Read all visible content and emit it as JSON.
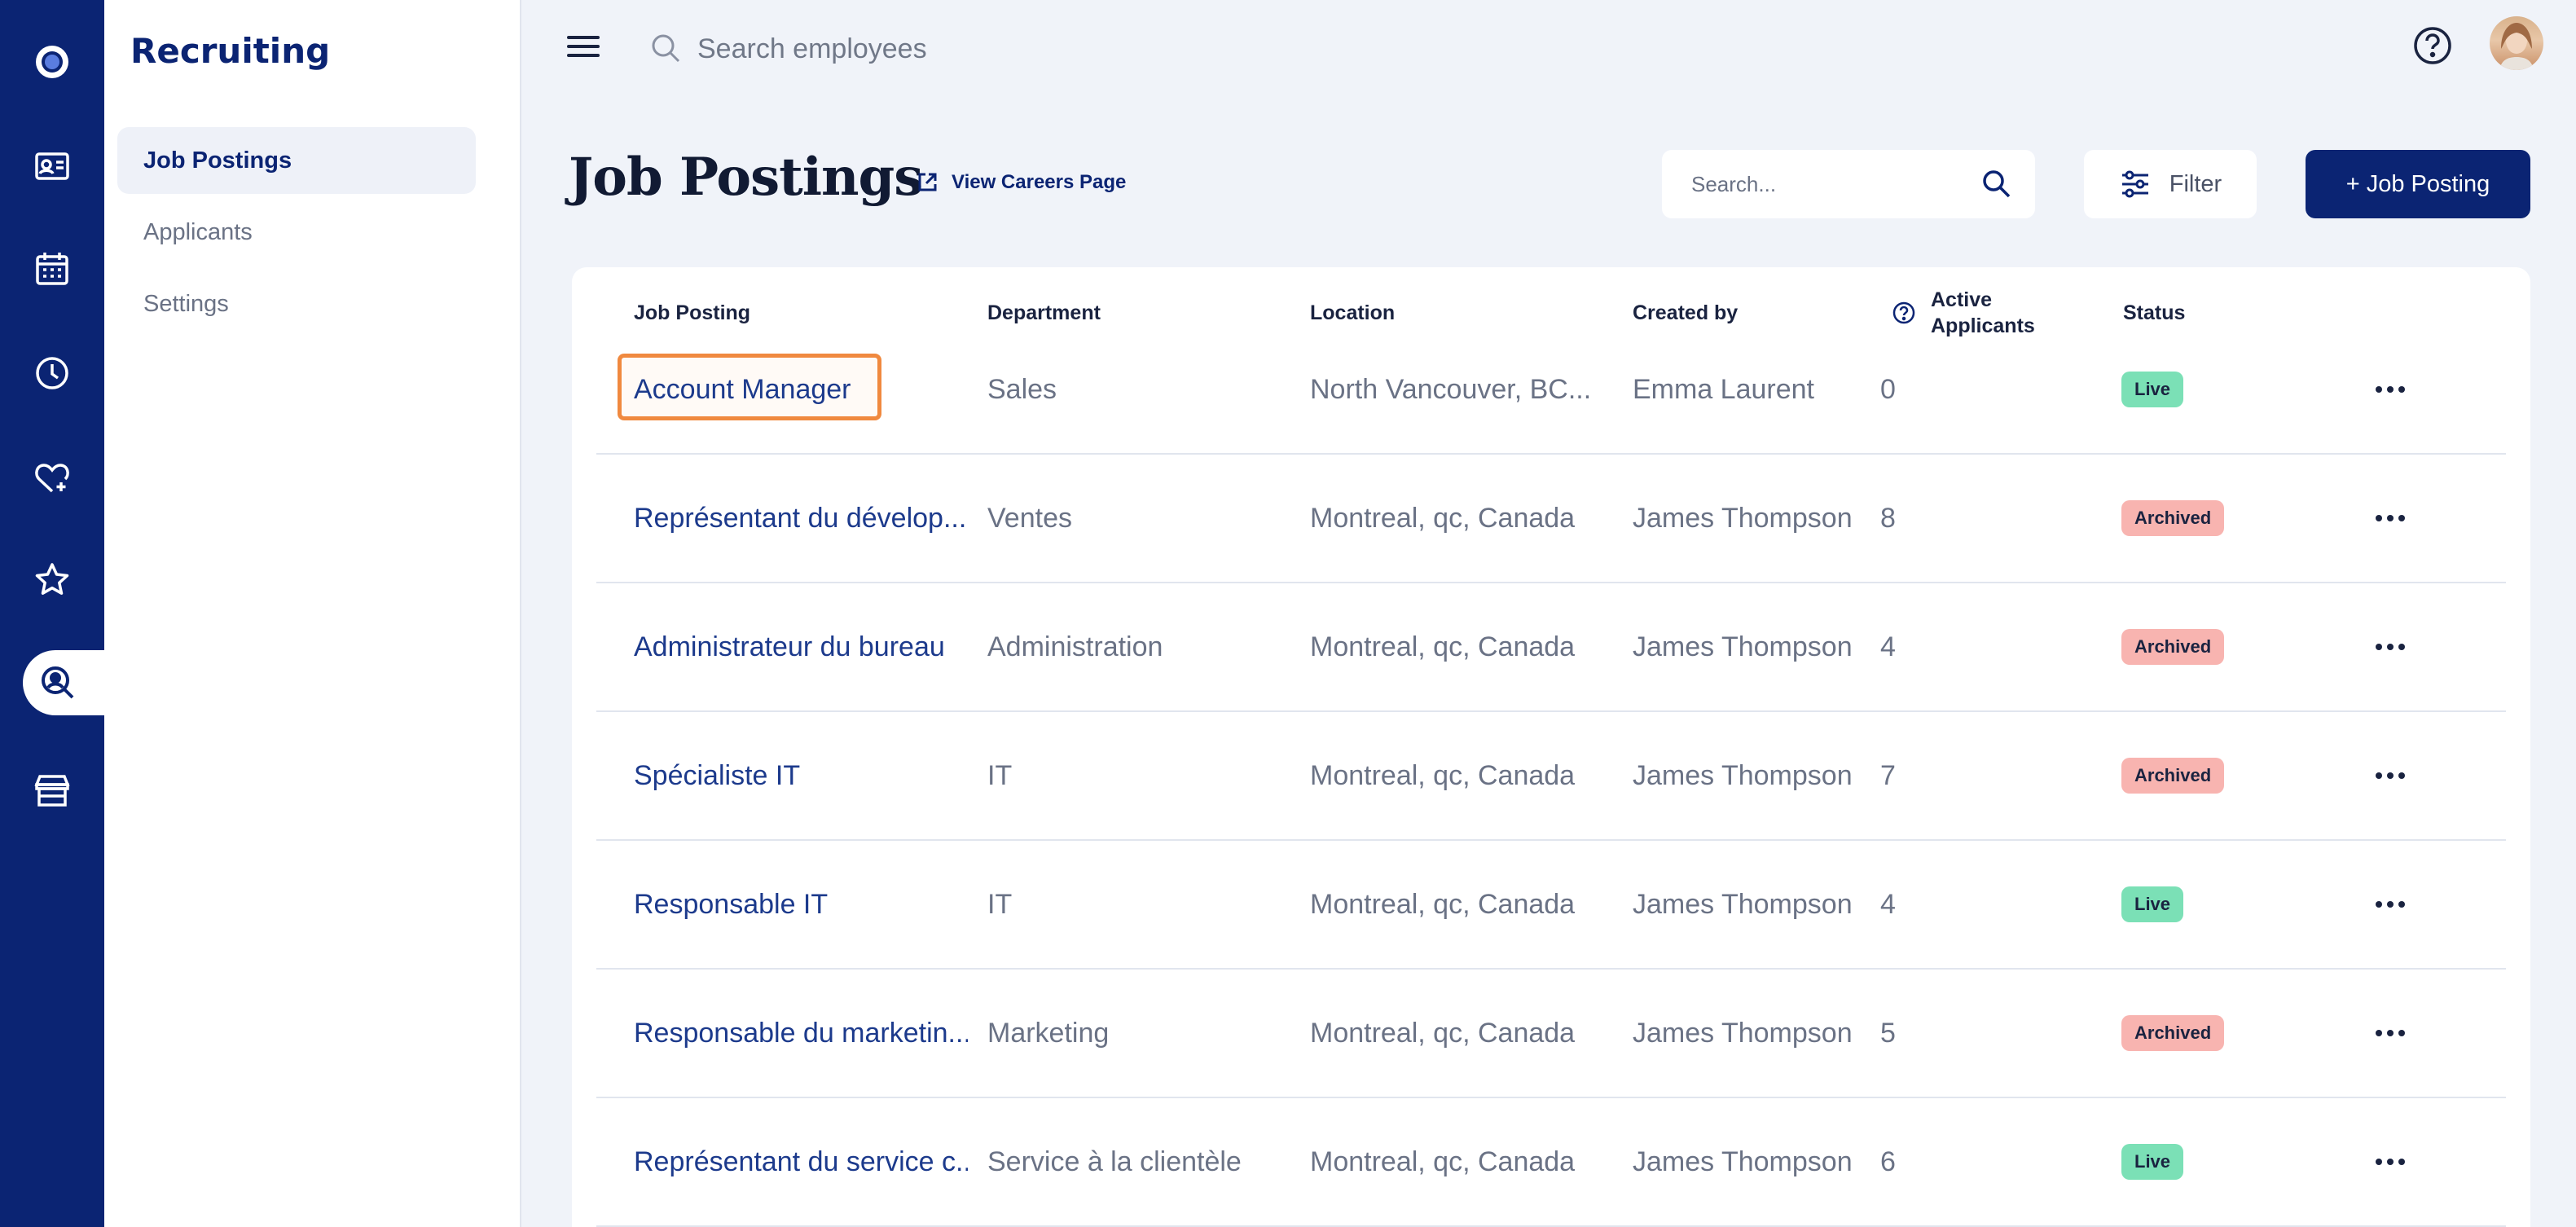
{
  "rail": {
    "items": [
      "logo-icon",
      "id-card-icon",
      "calendar-icon",
      "clock-icon",
      "heart-plus-icon",
      "star-icon",
      "recruiting-search-icon",
      "store-icon"
    ]
  },
  "subnav": {
    "title": "Recruiting",
    "items": [
      {
        "label": "Job Postings",
        "active": true
      },
      {
        "label": "Applicants",
        "active": false
      },
      {
        "label": "Settings",
        "active": false
      }
    ]
  },
  "topbar": {
    "search_placeholder": "Search employees"
  },
  "header": {
    "title": "Job Postings",
    "careers_link": "View Careers Page",
    "search_placeholder": "Search...",
    "filter_label": "Filter",
    "add_label": "+ Job Posting"
  },
  "table": {
    "columns": {
      "job": "Job Posting",
      "department": "Department",
      "location": "Location",
      "created_by": "Created by",
      "active_applicants_1": "Active",
      "active_applicants_2": "Applicants",
      "status": "Status"
    },
    "rows": [
      {
        "job": "Account Manager",
        "department": "Sales",
        "location": "North Vancouver, BC...",
        "created_by": "Emma Laurent",
        "applicants": "0",
        "status": "Live"
      },
      {
        "job": "Représentant du dévelop...",
        "department": "Ventes",
        "location": "Montreal, qc, Canada",
        "created_by": "James Thompson",
        "applicants": "8",
        "status": "Archived"
      },
      {
        "job": "Administrateur du bureau",
        "department": "Administration",
        "location": "Montreal, qc, Canada",
        "created_by": "James Thompson",
        "applicants": "4",
        "status": "Archived"
      },
      {
        "job": "Spécialiste IT",
        "department": "IT",
        "location": "Montreal, qc, Canada",
        "created_by": "James Thompson",
        "applicants": "7",
        "status": "Archived"
      },
      {
        "job": "Responsable IT",
        "department": "IT",
        "location": "Montreal, qc, Canada",
        "created_by": "James Thompson",
        "applicants": "4",
        "status": "Live"
      },
      {
        "job": "Responsable du marketin...",
        "department": "Marketing",
        "location": "Montreal, qc, Canada",
        "created_by": "James Thompson",
        "applicants": "5",
        "status": "Archived"
      },
      {
        "job": "Représentant du service c...",
        "department": "Service à la clientèle",
        "location": "Montreal, qc, Canada",
        "created_by": "James Thompson",
        "applicants": "6",
        "status": "Live"
      }
    ]
  },
  "colors": {
    "brand": "#0b2473",
    "live": "#7be0b6",
    "archived": "#f8b4b0",
    "highlight": "#f0893f"
  }
}
